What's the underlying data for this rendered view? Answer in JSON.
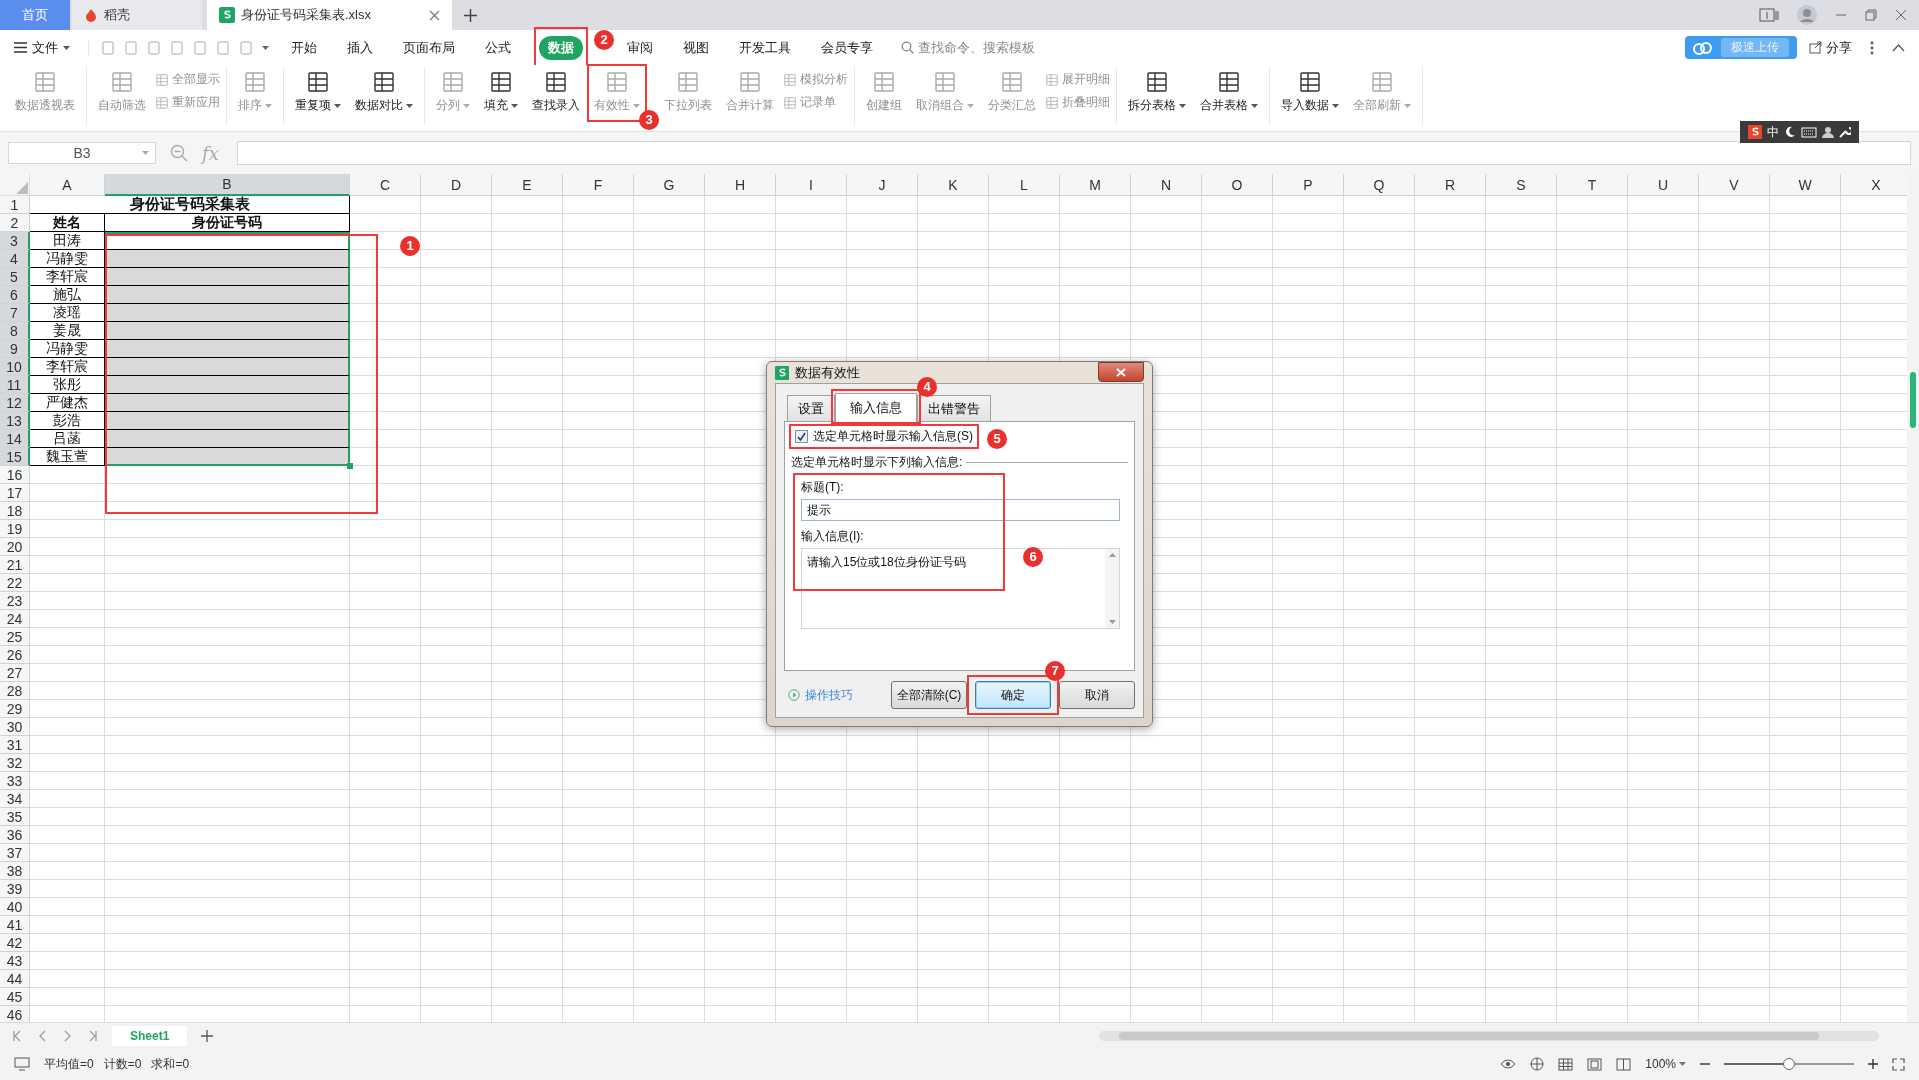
{
  "tabs": [
    {
      "kind": "home",
      "label": "首页",
      "selected": false
    },
    {
      "kind": "docer",
      "label": "稻壳",
      "selected": false
    },
    {
      "kind": "sheet",
      "label": "身份证号码采集表.xlsx",
      "selected": true
    }
  ],
  "menu": {
    "file": "文件",
    "items": [
      {
        "label": "开始",
        "selected": false
      },
      {
        "label": "插入",
        "selected": false
      },
      {
        "label": "页面布局",
        "selected": false
      },
      {
        "label": "公式",
        "selected": false
      },
      {
        "label": "数据",
        "selected": true,
        "annotation": "2"
      },
      {
        "label": "审阅",
        "selected": false
      },
      {
        "label": "视图",
        "selected": false
      },
      {
        "label": "开发工具",
        "selected": false
      },
      {
        "label": "会员专享",
        "selected": false
      }
    ],
    "search": {
      "placeholder": "查找命令、搜索模板"
    },
    "upload_tip": "极速上传",
    "share": "分享"
  },
  "ribbon": [
    [
      {
        "kind": "large",
        "label": "数据透视表",
        "disabled": true,
        "dropdown": false
      }
    ],
    [
      {
        "kind": "large",
        "label": "自动筛选",
        "disabled": true,
        "dropdown": false
      },
      {
        "kind": "stack",
        "items": [
          {
            "label": "全部显示",
            "disabled": true
          },
          {
            "label": "重新应用",
            "disabled": true
          }
        ]
      }
    ],
    [
      {
        "kind": "large",
        "label": "排序",
        "disabled": true,
        "dropdown": true
      }
    ],
    [
      {
        "kind": "large",
        "label": "重复项",
        "disabled": false,
        "dropdown": true
      },
      {
        "kind": "large",
        "label": "数据对比",
        "disabled": false,
        "dropdown": true
      }
    ],
    [
      {
        "kind": "large",
        "label": "分列",
        "disabled": true,
        "dropdown": true
      },
      {
        "kind": "large",
        "label": "填充",
        "disabled": false,
        "dropdown": true
      },
      {
        "kind": "large",
        "label": "查找录入",
        "disabled": false,
        "dropdown": false
      },
      {
        "kind": "large",
        "label": "有效性",
        "disabled": true,
        "dropdown": true,
        "annotation": "3"
      },
      {
        "kind": "large",
        "label": "下拉列表",
        "disabled": true,
        "dropdown": false
      },
      {
        "kind": "large",
        "label": "合并计算",
        "disabled": true,
        "dropdown": false
      },
      {
        "kind": "stack",
        "items": [
          {
            "label": "模拟分析",
            "disabled": true
          },
          {
            "label": "记录单",
            "disabled": true
          }
        ]
      }
    ],
    [
      {
        "kind": "large",
        "label": "创建组",
        "disabled": true,
        "dropdown": false
      },
      {
        "kind": "large",
        "label": "取消组合",
        "disabled": true,
        "dropdown": true
      },
      {
        "kind": "large",
        "label": "分类汇总",
        "disabled": true,
        "dropdown": false
      },
      {
        "kind": "stack",
        "items": [
          {
            "label": "展开明细",
            "disabled": true
          },
          {
            "label": "折叠明细",
            "disabled": true
          }
        ]
      }
    ],
    [
      {
        "kind": "large",
        "label": "拆分表格",
        "disabled": false,
        "dropdown": true
      },
      {
        "kind": "large",
        "label": "合并表格",
        "disabled": false,
        "dropdown": true
      }
    ],
    [
      {
        "kind": "large",
        "label": "导入数据",
        "disabled": false,
        "dropdown": true
      },
      {
        "kind": "large",
        "label": "全部刷新",
        "disabled": true,
        "dropdown": true
      }
    ]
  ],
  "ime": {
    "mode": "中"
  },
  "formula": {
    "name_box": "B3",
    "fx": "fx"
  },
  "sheet": {
    "annotation": "1",
    "columns": [
      {
        "label": "A",
        "selected": false
      },
      {
        "label": "B",
        "selected": true
      },
      {
        "label": "C",
        "selected": false
      },
      {
        "label": "D",
        "selected": false
      },
      {
        "label": "E",
        "selected": false
      },
      {
        "label": "F",
        "selected": false
      },
      {
        "label": "G",
        "selected": false
      },
      {
        "label": "H",
        "selected": false
      },
      {
        "label": "I",
        "selected": false
      },
      {
        "label": "J",
        "selected": false
      },
      {
        "label": "K",
        "selected": false
      },
      {
        "label": "L",
        "selected": false
      },
      {
        "label": "M",
        "selected": false
      },
      {
        "label": "N",
        "selected": false
      },
      {
        "label": "O",
        "selected": false
      },
      {
        "label": "P",
        "selected": false
      },
      {
        "label": "Q",
        "selected": false
      },
      {
        "label": "R",
        "selected": false
      },
      {
        "label": "S",
        "selected": false
      },
      {
        "label": "T",
        "selected": false
      },
      {
        "label": "U",
        "selected": false
      },
      {
        "label": "V",
        "selected": false
      },
      {
        "label": "W",
        "selected": false
      },
      {
        "label": "X",
        "selected": false
      }
    ],
    "row_numbers": [
      {
        "label": "1",
        "selected": false
      },
      {
        "label": "2",
        "selected": false
      },
      {
        "label": "3",
        "selected": true
      },
      {
        "label": "4",
        "selected": true
      },
      {
        "label": "5",
        "selected": true
      },
      {
        "label": "6",
        "selected": true
      },
      {
        "label": "7",
        "selected": true
      },
      {
        "label": "8",
        "selected": true
      },
      {
        "label": "9",
        "selected": true
      },
      {
        "label": "10",
        "selected": true
      },
      {
        "label": "11",
        "selected": true
      },
      {
        "label": "12",
        "selected": true
      },
      {
        "label": "13",
        "selected": true
      },
      {
        "label": "14",
        "selected": true
      },
      {
        "label": "15",
        "selected": true
      },
      {
        "label": "16",
        "selected": false
      },
      {
        "label": "17",
        "selected": false
      },
      {
        "label": "18",
        "selected": false
      },
      {
        "label": "19",
        "selected": false
      },
      {
        "label": "20",
        "selected": false
      },
      {
        "label": "21",
        "selected": false
      },
      {
        "label": "22",
        "selected": false
      },
      {
        "label": "23",
        "selected": false
      },
      {
        "label": "24",
        "selected": false
      },
      {
        "label": "25",
        "selected": false
      },
      {
        "label": "26",
        "selected": false
      },
      {
        "label": "27",
        "selected": false
      },
      {
        "label": "28",
        "selected": false
      },
      {
        "label": "29",
        "selected": false
      },
      {
        "label": "30",
        "selected": false
      },
      {
        "label": "31",
        "selected": false
      },
      {
        "label": "32",
        "selected": false
      },
      {
        "label": "33",
        "selected": false
      },
      {
        "label": "34",
        "selected": false
      },
      {
        "label": "35",
        "selected": false
      },
      {
        "label": "36",
        "selected": false
      },
      {
        "label": "37",
        "selected": false
      },
      {
        "label": "38",
        "selected": false
      },
      {
        "label": "39",
        "selected": false
      },
      {
        "label": "40",
        "selected": false
      },
      {
        "label": "41",
        "selected": false
      },
      {
        "label": "42",
        "selected": false
      },
      {
        "label": "43",
        "selected": false
      },
      {
        "label": "44",
        "selected": false
      },
      {
        "label": "45",
        "selected": false
      },
      {
        "label": "46",
        "selected": false
      }
    ],
    "title": "身份证号码采集表",
    "headers": [
      "姓名",
      "身份证号码"
    ],
    "records": [
      {
        "name": "田涛",
        "shaded": false
      },
      {
        "name": "冯静雯",
        "shaded": true
      },
      {
        "name": "李轩宸",
        "shaded": true
      },
      {
        "name": "施弘",
        "shaded": true
      },
      {
        "name": "凌瑶",
        "shaded": true
      },
      {
        "name": "姜晟",
        "shaded": true
      },
      {
        "name": "冯静雯",
        "shaded": true
      },
      {
        "name": "李轩宸",
        "shaded": true
      },
      {
        "name": "张彤",
        "shaded": true
      },
      {
        "name": "严健杰",
        "shaded": true
      },
      {
        "name": "彭浩",
        "shaded": true
      },
      {
        "name": "吕菡",
        "shaded": true
      },
      {
        "name": "魏玉萱",
        "shaded": true
      }
    ]
  },
  "sheet_tabs": [
    {
      "label": "Sheet1",
      "selected": true
    }
  ],
  "status": {
    "stats": [
      "平均值=0",
      "计数=0",
      "求和=0"
    ],
    "zoom": {
      "label": "100%",
      "level": 0.5
    }
  },
  "dialog": {
    "title": "数据有效性",
    "tabs": [
      {
        "label": "设置",
        "selected": false
      },
      {
        "label": "输入信息",
        "selected": true,
        "annotation": "4"
      },
      {
        "label": "出错警告",
        "selected": false
      }
    ],
    "checkbox": {
      "label": "选定单元格时显示输入信息(S)",
      "checked": true,
      "annotation": "5"
    },
    "group_label": "选定单元格时显示下列输入信息:",
    "fields_annotation": "6",
    "title_label": "标题(T):",
    "title_value": "提示",
    "message_label": "输入信息(I):",
    "message_value": "请输入15位或18位身份证号码",
    "tips": "操作技巧",
    "buttons": [
      {
        "label": "全部清除(C)",
        "default": false
      },
      {
        "label": "确定",
        "default": true,
        "annotation": "7"
      },
      {
        "label": "取消",
        "default": false
      }
    ]
  }
}
